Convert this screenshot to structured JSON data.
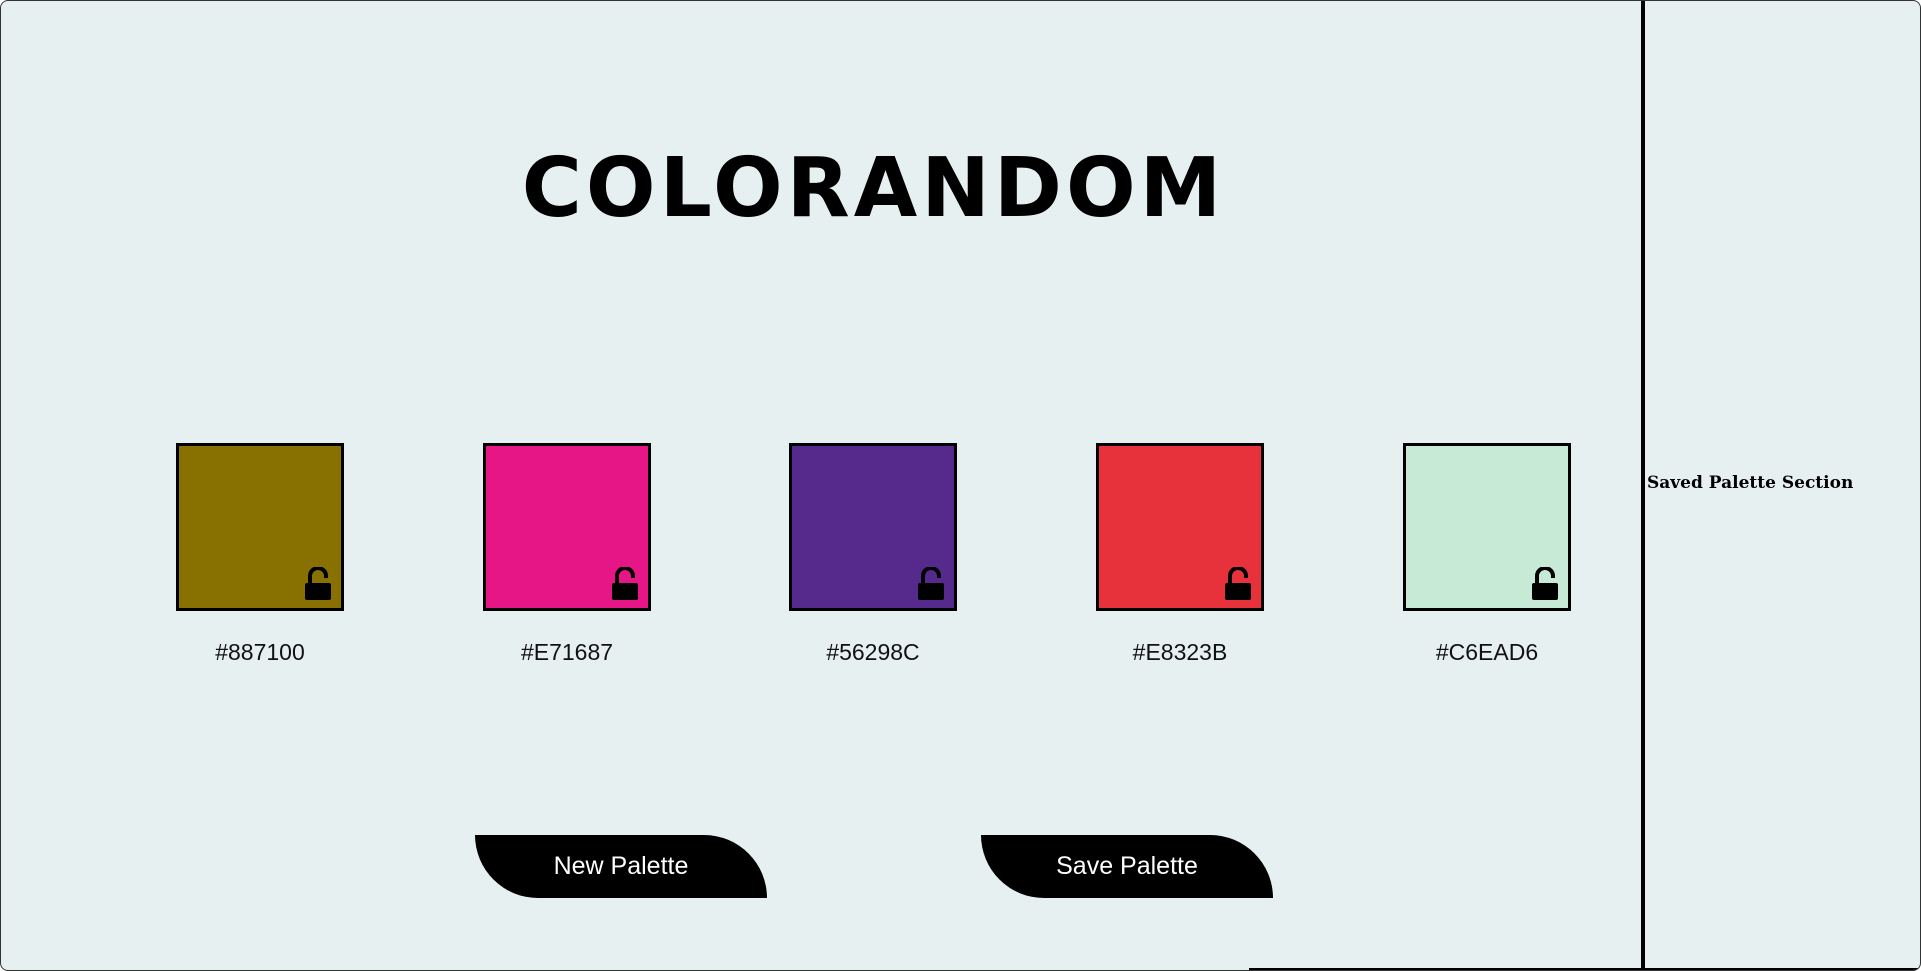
{
  "app": {
    "title": "COLORANDOM"
  },
  "palette": [
    {
      "hex": "#887100",
      "color": "#887100",
      "locked": false,
      "icon": "unlock-icon"
    },
    {
      "hex": "#E71687",
      "color": "#E71687",
      "locked": false,
      "icon": "unlock-icon"
    },
    {
      "hex": "#56298C",
      "color": "#56298C",
      "locked": false,
      "icon": "unlock-icon"
    },
    {
      "hex": "#E8323B",
      "color": "#E8323B",
      "locked": false,
      "icon": "unlock-icon"
    },
    {
      "hex": "#C6EAD6",
      "color": "#C6EAD6",
      "locked": false,
      "icon": "unlock-icon"
    }
  ],
  "buttons": {
    "new_palette": "New Palette",
    "save_palette": "Save Palette"
  },
  "saved_section": {
    "title": "Saved Palette Section"
  },
  "colors": {
    "background": "#e7f0f1",
    "button_bg": "#000000",
    "button_text": "#ffffff"
  }
}
